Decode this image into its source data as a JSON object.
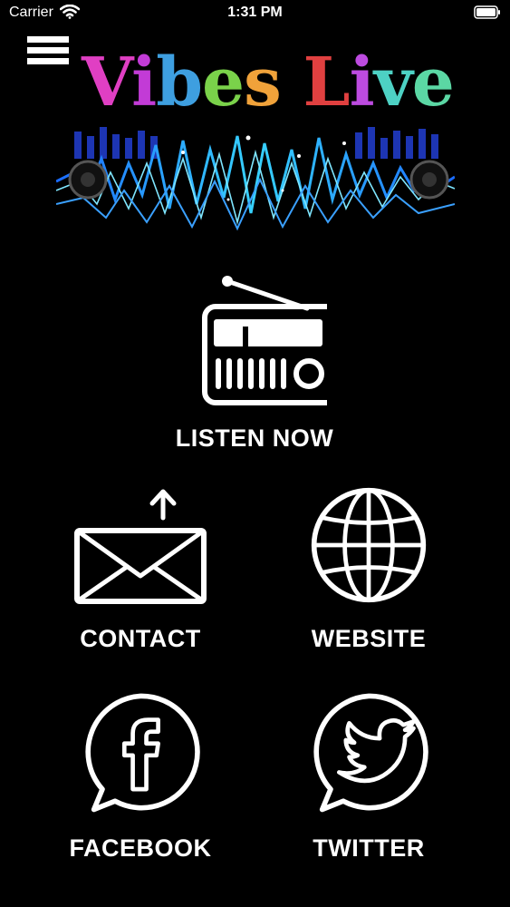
{
  "status_bar": {
    "carrier": "Carrier",
    "time": "1:31 PM",
    "wifi_icon": "wifi-icon",
    "battery_icon": "battery-icon"
  },
  "header": {
    "menu_icon": "hamburger-menu-icon",
    "logo_text": "Vibes Live",
    "logo_colors": [
      "#e03fc3",
      "#c23bd6",
      "#3e9fe0",
      "#7ad24a",
      "#f0a23a",
      "#e04040",
      "#bd4be0",
      "#4dd1c4",
      "#5bd7a4"
    ]
  },
  "tiles": {
    "listen": {
      "label": "LISTEN NOW",
      "icon": "radio-icon"
    },
    "contact": {
      "label": "CONTACT",
      "icon": "envelope-icon"
    },
    "website": {
      "label": "WEBSITE",
      "icon": "globe-icon"
    },
    "facebook": {
      "label": "FACEBOOK",
      "icon": "facebook-icon"
    },
    "twitter": {
      "label": "TWITTER",
      "icon": "twitter-icon"
    }
  },
  "colors": {
    "background": "#000000",
    "foreground": "#ffffff",
    "wave_glow": "#2aa8ff"
  }
}
